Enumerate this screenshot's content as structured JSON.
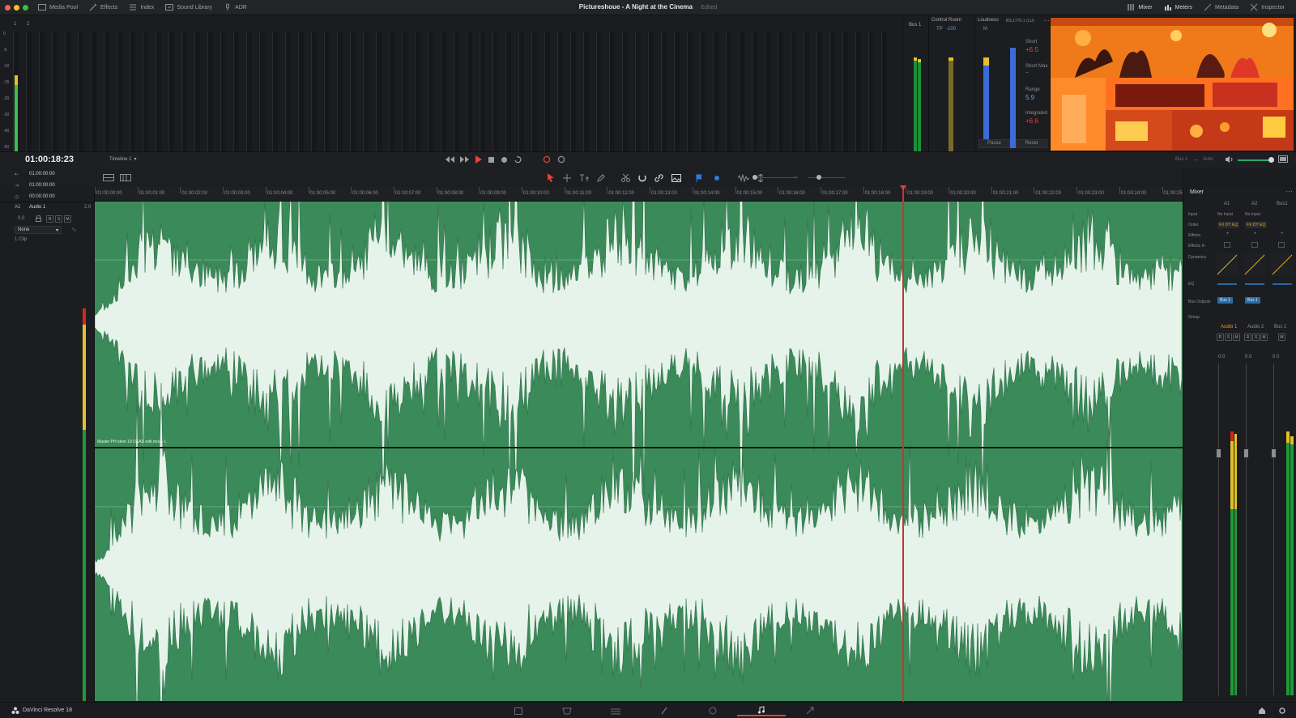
{
  "window": {
    "title": "Pictureshoue - A Night at the Cinema",
    "status": "Edited"
  },
  "topbar": {
    "left": [
      {
        "label": "Media Pool",
        "icon": "media-pool-icon"
      },
      {
        "label": "Effects",
        "icon": "effects-icon"
      },
      {
        "label": "Index",
        "icon": "index-icon"
      },
      {
        "label": "Sound Library",
        "icon": "sound-library-icon"
      },
      {
        "label": "ADR",
        "icon": "adr-icon"
      }
    ],
    "right": [
      {
        "label": "Mixer",
        "icon": "mixer-icon"
      },
      {
        "label": "Meters",
        "icon": "meters-icon"
      },
      {
        "label": "Metadata",
        "icon": "metadata-icon"
      },
      {
        "label": "Inspector",
        "icon": "inspector-icon"
      }
    ]
  },
  "meters": {
    "scale": [
      "0",
      "-5",
      "-10",
      "-15",
      "-20",
      "-30",
      "-40",
      "-50"
    ],
    "track_nums": [
      "1",
      "2"
    ]
  },
  "bus": {
    "label": "Bus 1"
  },
  "control_room": {
    "title": "Control Room",
    "tp_label": "TP",
    "tp_value": "-100"
  },
  "loudness": {
    "title": "Loudness",
    "standard": "BS.1770-1 (LU)",
    "m_label": "M",
    "short_label": "Short",
    "short_value": "+6.5",
    "shortmax_label": "Short Max",
    "shortmax_value": "--",
    "range_label": "Range",
    "range_value": "5.9",
    "integrated_label": "Integrated",
    "integrated_value": "+6.6",
    "pause": "Pause",
    "reset": "Reset"
  },
  "transport": {
    "timecode": "01:00:18:23",
    "timeline": "Timeline 1",
    "bus_out": "Bus 1",
    "auto": "Auto"
  },
  "track_header": {
    "tc1": "01:00:00:00",
    "tc2": "01:00:00:00",
    "tc3": "00:00:00:00",
    "track_id": "A1",
    "track_name": "Audio 1",
    "level": "2.0",
    "volume": "0.0",
    "s_label": "S",
    "m_label": "M",
    "r_label": "R",
    "effect_select": "None",
    "clip_count": "1 Clip"
  },
  "ruler": {
    "ticks": [
      "01:00:00:00",
      "01:00:01:00",
      "01:00:02:00",
      "01:00:03:00",
      "01:00:04:00",
      "01:00:05:00",
      "01:00:06:00",
      "01:00:07:00",
      "01:00:08:00",
      "01:00:09:00",
      "01:00:10:00",
      "01:00:11:00",
      "01:00:12:00",
      "01:00:13:00",
      "01:00:14:00",
      "01:00:15:00",
      "01:00:16:00",
      "01:00:17:00",
      "01:00:18:00",
      "01:00:19:00",
      "01:00:20:00",
      "01:00:21:00",
      "01:00:22:00",
      "01:00:23:00",
      "01:00:24:00",
      "01:00:25"
    ]
  },
  "clip": {
    "name": "Master PH ident 19 D&AD edit.mov - L"
  },
  "mixer": {
    "title": "Mixer",
    "cols": [
      "A1",
      "A2",
      "Bus1"
    ],
    "rows": {
      "input": "Input",
      "order": "Order",
      "effects": "Effects",
      "effects_in": "Effects In",
      "dynamics": "Dynamics",
      "eq": "EQ",
      "bus_outputs": "Bus Outputs",
      "group": "Group"
    },
    "input_values": [
      "No Input",
      "No Input"
    ],
    "order_values": [
      "FX DY EQ",
      "FX DY EQ"
    ],
    "bus_out_values": [
      "Bus 1",
      "Bus 1"
    ],
    "channel_names": [
      "Audio 1",
      "Audio 2",
      "Bus 1"
    ],
    "levels": [
      "0.0",
      "0.0",
      "0.0"
    ],
    "scale": [
      "0",
      "-5",
      "-10",
      "-15",
      "-20",
      "-30",
      "-40",
      "-50"
    ]
  },
  "bottombar": {
    "app": "DaVinci Resolve 18"
  },
  "colors": {
    "accent_red": "#e0443a",
    "clip_green": "#3b8a5a",
    "wave": "#e6f3ea",
    "meter_green": "#3fbf4f",
    "meter_yellow": "#e2c22a"
  }
}
